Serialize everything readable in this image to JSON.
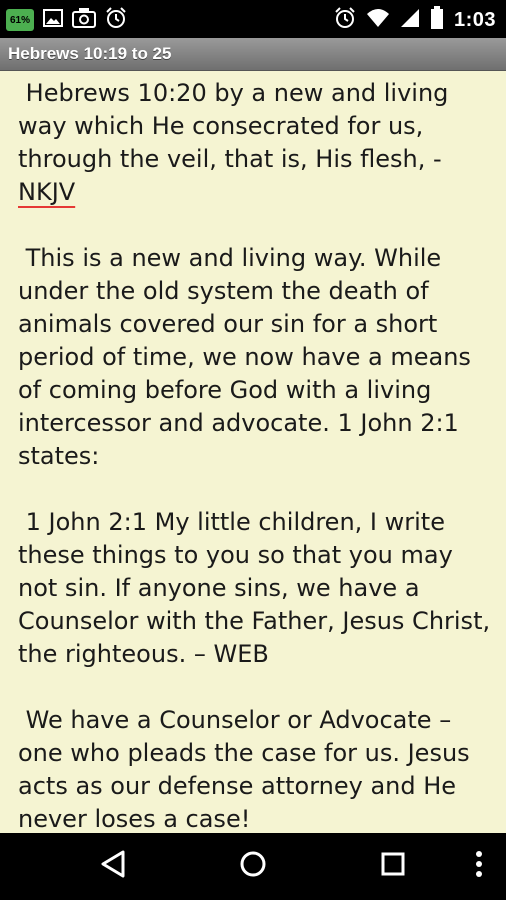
{
  "status_bar": {
    "battery_left": "61%",
    "time": "1:03"
  },
  "title_bar": {
    "title": "Hebrews 10:19 to 25"
  },
  "content": {
    "p1_text": " Hebrews 10:20 by a new and living way which He consecrated for us, through the veil, that is, His flesh, - ",
    "p1_ref": "NKJV",
    "p2": " This is a new and living way. While under the old system the death of animals covered our sin for a short period of time, we now have a means of coming before God with a living intercessor and advocate. 1 John 2:1 states:",
    "p3": " 1 John 2:1 My little children, I write these things to you so that you may not sin. If anyone sins, we have a Counselor with the Father, Jesus Christ, the righteous. – WEB",
    "p4": " We have a Counselor or Advocate – one who pleads the case for us. Jesus acts as our defense attorney and He never loses a case!"
  },
  "icons": {
    "status_left": [
      "battery-icon",
      "image-icon",
      "camera-icon",
      "alarm-icon"
    ],
    "status_right": [
      "alarm-icon",
      "wifi-icon",
      "signal-icon",
      "battery-icon"
    ],
    "nav": [
      "back-icon",
      "home-icon",
      "recents-icon",
      "more-icon"
    ]
  }
}
